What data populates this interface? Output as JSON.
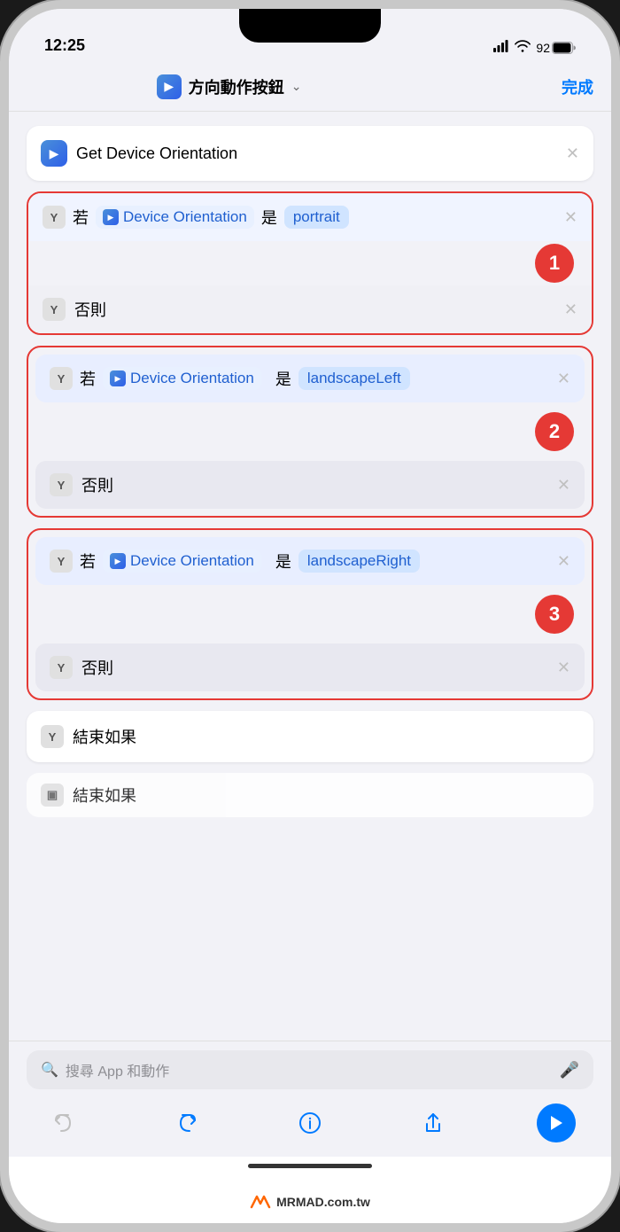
{
  "status": {
    "time": "12:25",
    "battery": "92",
    "signal": "●●●●",
    "wifi": "wifi"
  },
  "nav": {
    "title": "方向動作按鈕",
    "done": "完成",
    "icon": "▶"
  },
  "blocks": {
    "get_device": "Get Device Orientation",
    "if_label": "若",
    "is_label": "是",
    "else_label": "否則",
    "end_if": "結束如果",
    "end_if2": "結束如果",
    "device_orientation": "Device Orientation",
    "value1": "portrait",
    "value2": "landscapeLeft",
    "value3": "landscapeRight",
    "badge1": "1",
    "badge2": "2",
    "badge3": "3"
  },
  "search": {
    "placeholder": "搜尋 App 和動作"
  },
  "watermark": {
    "text": "MRMAD.com.tw"
  }
}
